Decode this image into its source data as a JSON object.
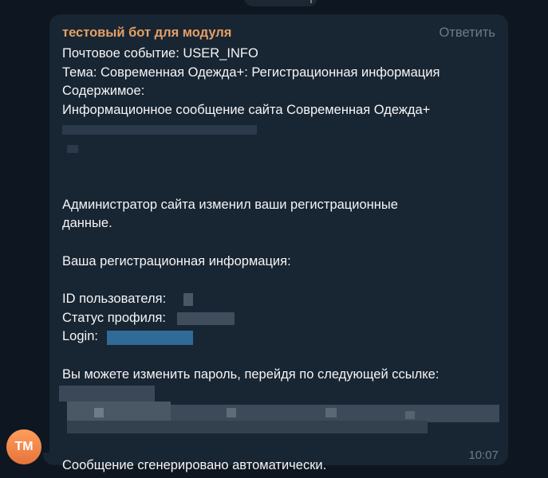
{
  "message": {
    "sender": "тестовый бот для модуля",
    "reply_label": "Ответить",
    "time": "10:07",
    "avatar_initials": "TM",
    "lines": {
      "l1": "Почтовое событие: USER_INFO",
      "l2": "Тема: Современная Одежда+: Регистрационная информация",
      "l3": "Содержимое:",
      "l4": "Информационное сообщение сайта Современная Одежда+",
      "l5": "Администратор сайта изменил ваши регистрационные",
      "l6": "данные.",
      "l7": "Ваша регистрационная информация:",
      "l8": "ID пользователя:",
      "l9": "Статус профиля:",
      "l10": "Login:",
      "l11": "Вы можете изменить пароль, перейдя по следующей ссылке:",
      "l12": "Сообщение сгенерировано автоматически."
    }
  },
  "colors": {
    "background": "#0e1621",
    "bubble": "#182533",
    "sender": "#e5a064",
    "text": "#f5f5f5",
    "muted": "#6a7b8c",
    "avatar": "#f08c4d"
  }
}
